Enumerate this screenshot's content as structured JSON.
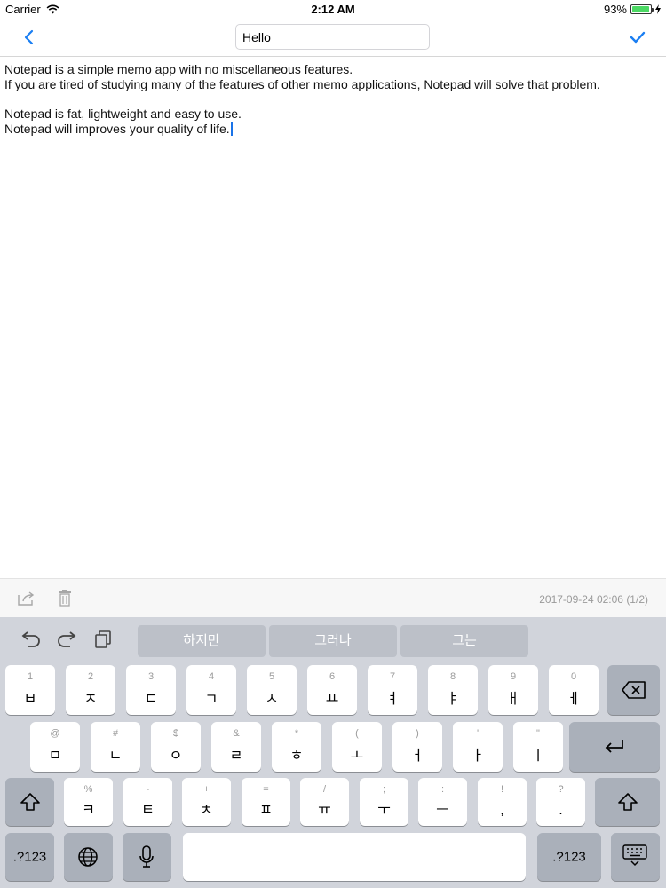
{
  "status": {
    "carrier": "Carrier",
    "time": "2:12 AM",
    "battery": "93%",
    "battery_level": 0.93
  },
  "nav": {
    "title_value": "Hello"
  },
  "memo": {
    "lines": [
      "Notepad is a simple memo app with no miscellaneous features.",
      "If you are tired of studying many of the features of other memo applications, Notepad will solve that problem.",
      "Notepad is fat, lightweight and easy to use.",
      "Notepad will improves your quality of life."
    ]
  },
  "toolbar": {
    "date": "2017-09-24 02:06 (1/2)"
  },
  "keyboard": {
    "suggestions": [
      "하지만",
      "그러나",
      "그는"
    ],
    "row1": [
      {
        "num": "1",
        "char": "ㅂ"
      },
      {
        "num": "2",
        "char": "ㅈ"
      },
      {
        "num": "3",
        "char": "ㄷ"
      },
      {
        "num": "4",
        "char": "ㄱ"
      },
      {
        "num": "5",
        "char": "ㅅ"
      },
      {
        "num": "6",
        "char": "ㅛ"
      },
      {
        "num": "7",
        "char": "ㅕ"
      },
      {
        "num": "8",
        "char": "ㅑ"
      },
      {
        "num": "9",
        "char": "ㅐ"
      },
      {
        "num": "0",
        "char": "ㅔ"
      }
    ],
    "row2": [
      {
        "num": "@",
        "char": "ㅁ"
      },
      {
        "num": "#",
        "char": "ㄴ"
      },
      {
        "num": "$",
        "char": "ㅇ"
      },
      {
        "num": "&",
        "char": "ㄹ"
      },
      {
        "num": "*",
        "char": "ㅎ"
      },
      {
        "num": "(",
        "char": "ㅗ"
      },
      {
        "num": ")",
        "char": "ㅓ"
      },
      {
        "num": "'",
        "char": "ㅏ"
      },
      {
        "num": "\"",
        "char": "ㅣ"
      }
    ],
    "row3": [
      {
        "num": "%",
        "char": "ㅋ"
      },
      {
        "num": "-",
        "char": "ㅌ"
      },
      {
        "num": "+",
        "char": "ㅊ"
      },
      {
        "num": "=",
        "char": "ㅍ"
      },
      {
        "num": "/",
        "char": "ㅠ"
      },
      {
        "num": ";",
        "char": "ㅜ"
      },
      {
        "num": ":",
        "char": "ㅡ"
      },
      {
        "num": "!",
        "char": ","
      },
      {
        "num": "?",
        "char": "."
      }
    ],
    "numbers_label": ".?123"
  }
}
